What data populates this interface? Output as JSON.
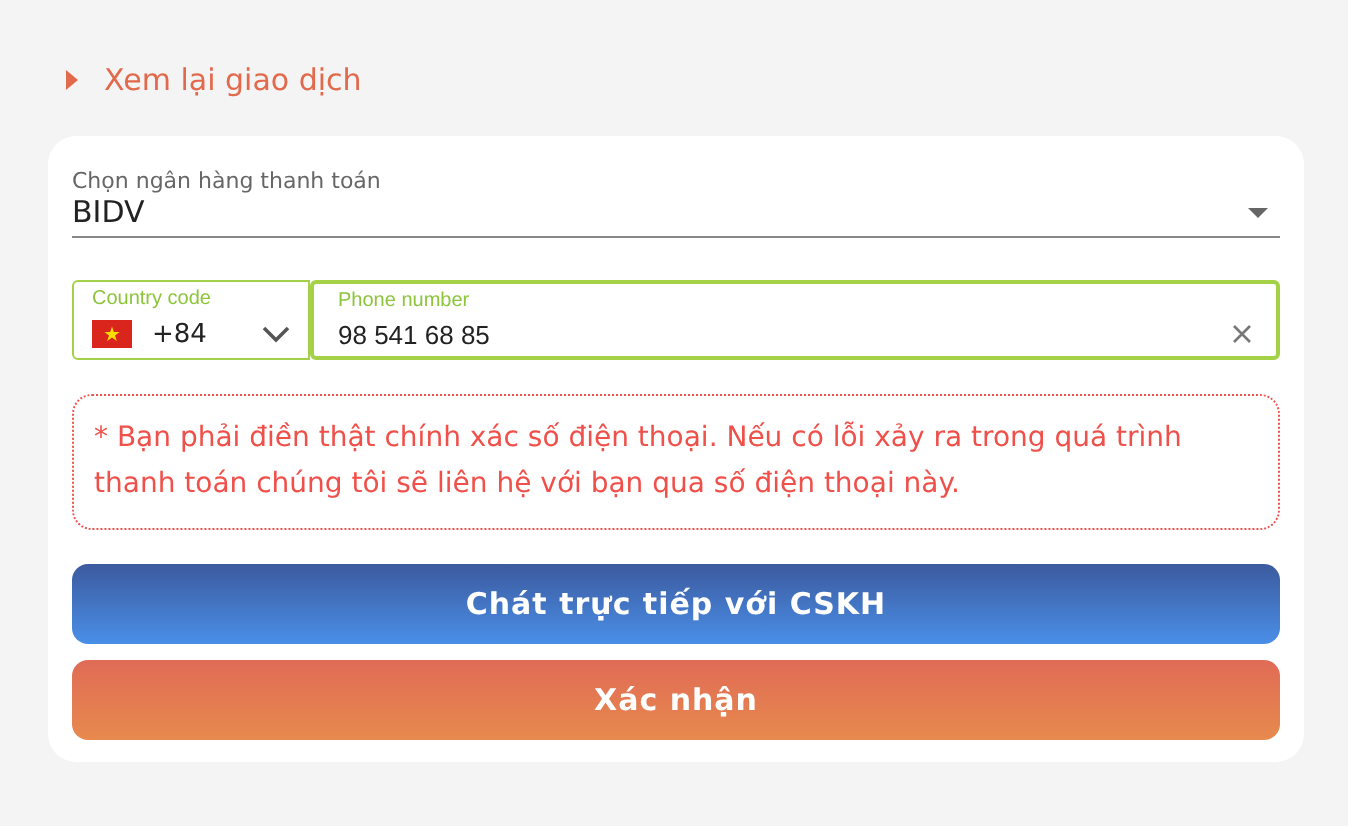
{
  "review_link": {
    "label": "Xem lại giao dịch",
    "expanded": false
  },
  "bank_select": {
    "label": "Chọn ngân hàng thanh toán",
    "value": "BIDV"
  },
  "country_code": {
    "label": "Country code",
    "value": "+84"
  },
  "phone": {
    "label": "Phone number",
    "value": "98 541 68 85"
  },
  "notice": "* Bạn phải điền thật chính xác số điện thoại. Nếu có lỗi xảy ra trong quá trình thanh toán chúng tôi sẽ liên hệ với bạn qua số điện thoại này.",
  "buttons": [
    {
      "label": "Chát trực tiếp với CSKH",
      "kind": "chat"
    },
    {
      "label": "Xác nhận",
      "kind": "confirm"
    }
  ]
}
